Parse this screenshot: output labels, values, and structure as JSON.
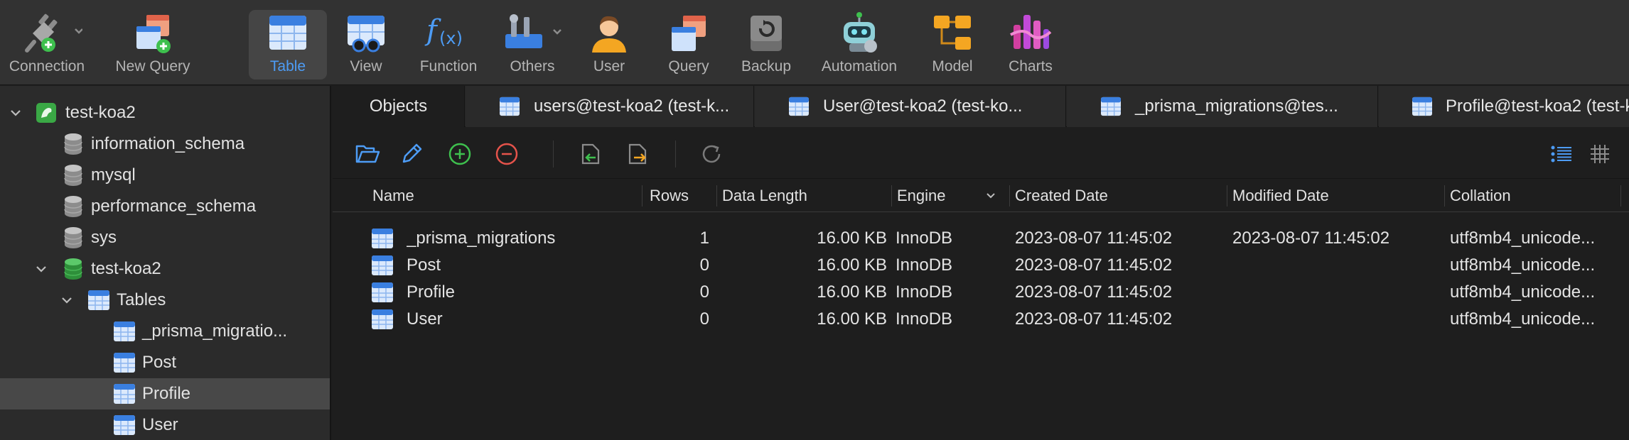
{
  "toolbar": {
    "connection": "Connection",
    "new_query": "New Query",
    "table": "Table",
    "view": "View",
    "function": "Function",
    "others": "Others",
    "user": "User",
    "query": "Query",
    "backup": "Backup",
    "automation": "Automation",
    "model": "Model",
    "charts": "Charts"
  },
  "sidebar": {
    "connection_name": "test-koa2",
    "databases": [
      "information_schema",
      "mysql",
      "performance_schema",
      "sys"
    ],
    "open_db": "test-koa2",
    "tables_label": "Tables",
    "tables": [
      "_prisma_migratio...",
      "Post",
      "Profile",
      "User"
    ],
    "selected_table": "Profile"
  },
  "tabs": [
    {
      "label": "Objects"
    },
    {
      "label": "users@test-koa2 (test-k..."
    },
    {
      "label": "User@test-koa2 (test-ko..."
    },
    {
      "label": "_prisma_migrations@tes..."
    },
    {
      "label": "Profile@test-koa2 (test-k"
    }
  ],
  "columns": {
    "name": "Name",
    "rows": "Rows",
    "data_length": "Data Length",
    "engine": "Engine",
    "created": "Created Date",
    "modified": "Modified Date",
    "collation": "Collation"
  },
  "objects": [
    {
      "name": "_prisma_migrations",
      "rows": "1",
      "data_length": "16.00 KB",
      "engine": "InnoDB",
      "created": "2023-08-07 11:45:02",
      "modified": "2023-08-07 11:45:02",
      "collation": "utf8mb4_unicode..."
    },
    {
      "name": "Post",
      "rows": "0",
      "data_length": "16.00 KB",
      "engine": "InnoDB",
      "created": "2023-08-07 11:45:02",
      "modified": "",
      "collation": "utf8mb4_unicode..."
    },
    {
      "name": "Profile",
      "rows": "0",
      "data_length": "16.00 KB",
      "engine": "InnoDB",
      "created": "2023-08-07 11:45:02",
      "modified": "",
      "collation": "utf8mb4_unicode..."
    },
    {
      "name": "User",
      "rows": "0",
      "data_length": "16.00 KB",
      "engine": "InnoDB",
      "created": "2023-08-07 11:45:02",
      "modified": "",
      "collation": "utf8mb4_unicode..."
    }
  ],
  "colors": {
    "accent": "#4d9cf5",
    "add": "#3ec04e",
    "remove": "#e5534b",
    "db_green": "#3aa845"
  }
}
